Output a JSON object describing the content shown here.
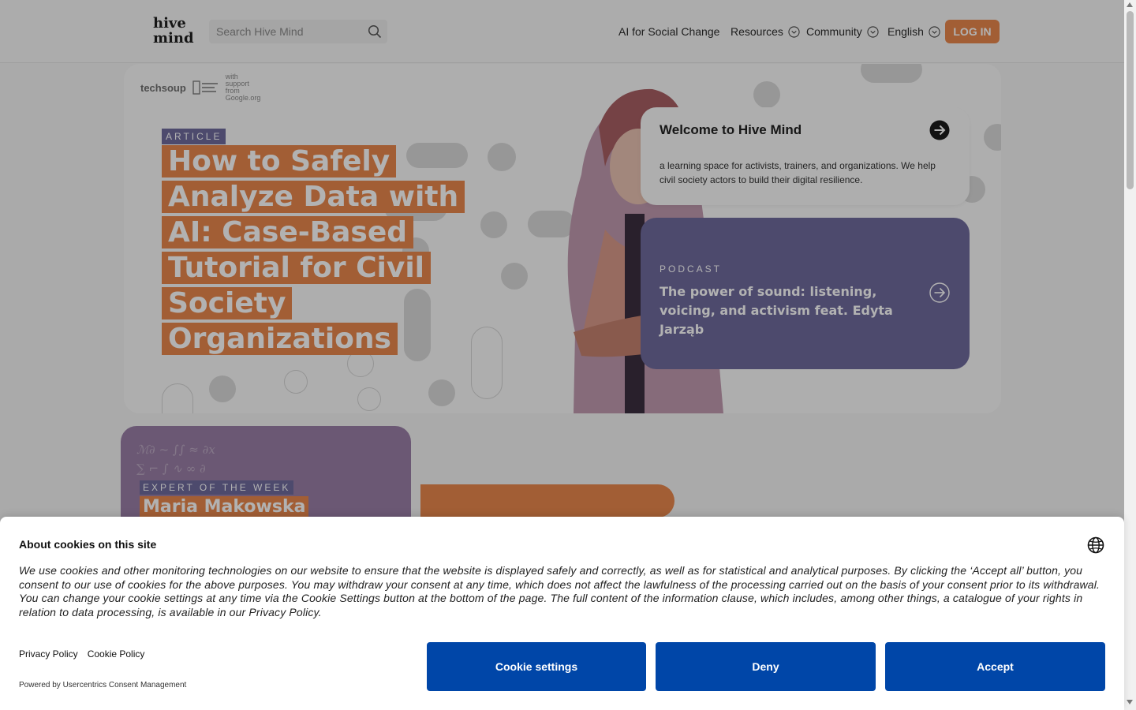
{
  "header": {
    "logo": "hive mind",
    "search_placeholder": "Search Hive Mind",
    "nav": {
      "ai": "AI for Social Change",
      "resources": "Resources",
      "community": "Community",
      "language": "English"
    },
    "login_label": "LOG IN"
  },
  "hero": {
    "partners": {
      "techsoup": "techsoup",
      "google": "with support from Google.org"
    },
    "article": {
      "tag": "ARTICLE",
      "title": "How to Safely Analyze Data with AI: Case-Based Tutorial for Civil Society Organizations"
    },
    "welcome": {
      "title": "Welcome to Hive Mind",
      "text": "a learning space for activists, trainers, and organizations. We help civil society actors to build their digital resilience."
    },
    "podcast": {
      "tag": "PODCAST",
      "title": "The power of sound: listening, voicing, and activism feat. Edyta Jarząb"
    }
  },
  "expert": {
    "tag": "EXPERT OF THE WEEK",
    "name": "Maria Makowska"
  },
  "cookie": {
    "title": "About cookies on this site",
    "description": "We use cookies and other monitoring technologies on our website to ensure that the website is displayed safely and correctly, as well as for statistical and analytical purposes. By clicking the ‘Accept  all’ button, you consent to our use of cookies for the above purposes. You may withdraw your consent at any time, which does not affect the lawfulness of the processing carried out on the basis of your consent prior to its withdrawal. You can change your cookie settings at any time via the Cookie Settings button at the bottom of the page. The full content of the information clause, which includes, among other things, a catalogue of your rights in relation to data processing, is available in our Privacy Policy.",
    "privacy_link": "Privacy Policy",
    "cookie_policy_link": "Cookie Policy",
    "powered_by": "Powered by Usercentrics Consent Management",
    "buttons": {
      "settings": "Cookie settings",
      "deny": "Deny",
      "accept": "Accept"
    }
  },
  "colors": {
    "accent_orange": "#e8874c",
    "accent_purple": "#6f6a9d",
    "cookie_button": "#0046a8"
  },
  "icons": {
    "search": "search-icon",
    "chevron": "chevron-down-icon",
    "arrow": "arrow-right-icon",
    "globe": "globe-icon"
  }
}
